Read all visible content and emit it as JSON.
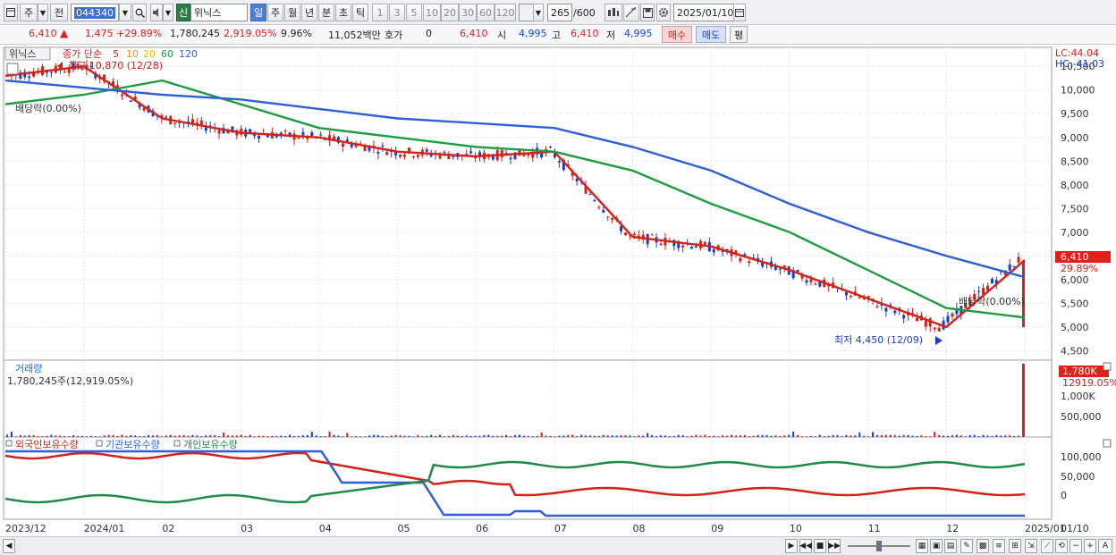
{
  "toolbar": {
    "period_main": "주",
    "prev_label": "전",
    "code": "044340",
    "new_label": "신",
    "stock_name": "위닉스",
    "periods": [
      "일",
      "주",
      "월",
      "년",
      "분",
      "초",
      "틱"
    ],
    "active_period": "일",
    "intervals": [
      "1",
      "3",
      "5",
      "10",
      "20",
      "30",
      "60",
      "120"
    ],
    "count": "265",
    "count_total": "/600",
    "date": "2025/01/10"
  },
  "quote": {
    "price": "6,410",
    "change": "1,475",
    "change_pct": "+29.89%",
    "volume": "1,780,245",
    "volume_pct": "2,919.05%",
    "turnover": "9.96%",
    "amount": "11,052백만",
    "hoga_label": "호가",
    "hoga_value": "0",
    "hoga_price": "6,410",
    "open_label": "시",
    "open": "4,995",
    "high_label": "고",
    "high": "6,410",
    "low_label": "저",
    "low": "4,995",
    "buy_label": "매수",
    "sell_label": "매도",
    "eval_label": "평"
  },
  "price_panel": {
    "name_tab": "위닉스",
    "ma_title": "종가 단순",
    "ma_periods": [
      "5",
      "10",
      "20",
      "60",
      "120"
    ],
    "ma_colors": [
      "#d2231b",
      "#f0901e",
      "#f5d300",
      "#1f9c3f",
      "#2f5fd8"
    ],
    "high_note": "최고 10,870 (12/28)",
    "low_note": "최저 4,450 (12/09)",
    "dividend_left": "배당락(0.00%)",
    "dividend_right": "배당락(0.00%)",
    "lc": "LC:44.04",
    "hc": "HC:-41.03",
    "last_price": "6,410",
    "last_pct": "29.89%",
    "y_ticks": [
      "10,500",
      "10,000",
      "9,500",
      "9,000",
      "8,500",
      "8,000",
      "7,500",
      "7,000",
      "6,500",
      "6,000",
      "5,500",
      "5,000",
      "4,500"
    ]
  },
  "volume_panel": {
    "title": "거래량",
    "value": "1,780,245주(12,919.05%)",
    "last": "1,780K",
    "last_pct": "12919.05%",
    "y_ticks": [
      "1,000K",
      "500,000"
    ]
  },
  "holding_panel": {
    "series": [
      {
        "name": "외국인보유수량",
        "color": "#d2231b"
      },
      {
        "name": "기관보유수량",
        "color": "#2f5fd8"
      },
      {
        "name": "개인보유수량",
        "color": "#1f8a4a"
      }
    ],
    "y_ticks": [
      "100,000",
      "50,000",
      "0"
    ]
  },
  "x_axis": [
    "2023/12",
    "2024/01",
    "02",
    "03",
    "04",
    "05",
    "06",
    "07",
    "08",
    "09",
    "10",
    "11",
    "12",
    "2025/01",
    "01/10"
  ],
  "colors": {
    "up": "#d2231b",
    "down": "#1a3fc6",
    "grid": "#d7dbe0"
  },
  "chart_data": {
    "type": "line",
    "title": "",
    "x": [
      "2023/12",
      "2024/01",
      "02",
      "03",
      "04",
      "05",
      "06",
      "07",
      "08",
      "09",
      "10",
      "11",
      "12",
      "2025/01"
    ],
    "series": [
      {
        "name": "종가 단순 5",
        "values": [
          10300,
          10500,
          9400,
          9100,
          9000,
          8700,
          8600,
          8700,
          6900,
          6700,
          6200,
          5600,
          5000,
          6410
        ]
      },
      {
        "name": "종가 단순 60",
        "values": [
          9700,
          9900,
          10200,
          9700,
          9200,
          9000,
          8800,
          8700,
          8300,
          7600,
          7000,
          6200,
          5400,
          5200
        ]
      },
      {
        "name": "종가 단순 120",
        "values": [
          10200,
          10050,
          9900,
          9800,
          9600,
          9400,
          9300,
          9200,
          8800,
          8300,
          7600,
          7000,
          6500,
          6050
        ]
      }
    ],
    "ylim": [
      4300,
      10900
    ]
  }
}
